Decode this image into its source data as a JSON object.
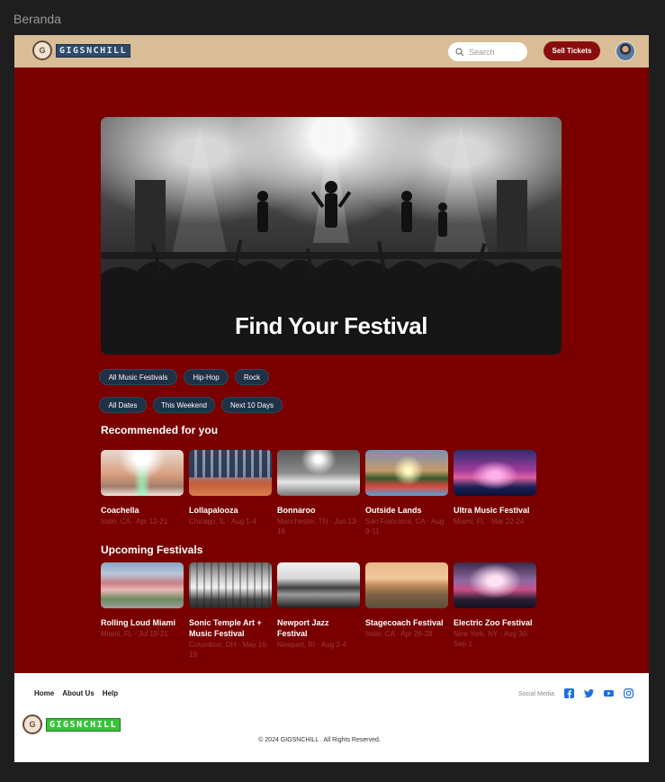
{
  "frame_title": "Beranda",
  "header": {
    "logo_mark": "G",
    "logo_text": "GIGSNCHILL",
    "search_placeholder": "Search",
    "sell_label": "Sell Tickets"
  },
  "hero": {
    "title": "Find Your Festival"
  },
  "filters": {
    "genres": [
      "All Music Festivals",
      "Hip-Hop",
      "Rock"
    ],
    "dates": [
      "All Dates",
      "This Weekend",
      "Next 10 Days"
    ]
  },
  "recommended": {
    "title": "Recommended for you",
    "items": [
      {
        "name": "Coachella",
        "date": "Indio, CA · Apr 12-21"
      },
      {
        "name": "Lollapalooza",
        "date": "Chicago, IL · Aug 1-4"
      },
      {
        "name": "Bonnaroo",
        "date": "Manchester, TN · Jun 13-16"
      },
      {
        "name": "Outside Lands",
        "date": "San Francisco, CA · Aug 9-11"
      },
      {
        "name": "Ultra Music Festival",
        "date": "Miami, FL · Mar 22-24"
      }
    ]
  },
  "upcoming": {
    "title": "Upcoming Festivals",
    "items": [
      {
        "name": "Rolling Loud Miami",
        "date": "Miami, FL · Jul 19-21"
      },
      {
        "name": "Sonic Temple Art + Music Festival",
        "date": "Columbus, OH · May 16-19"
      },
      {
        "name": "Newport Jazz Festival",
        "date": "Newport, RI · Aug 2-4"
      },
      {
        "name": "Stagecoach Festival",
        "date": "Indio, CA · Apr 26-28"
      },
      {
        "name": "Electric Zoo Festival",
        "date": "New York, NY · Aug 30-Sep 1"
      }
    ]
  },
  "footer": {
    "nav": {
      "home": "Home",
      "about": "About Us",
      "help": "Help"
    },
    "social_label": "Social Media",
    "social_icons": [
      "facebook-icon",
      "twitter-icon",
      "youtube-icon",
      "instagram-icon"
    ],
    "logo_text": "GIGSNCHILL",
    "copyright": "© 2024 GIGSNCHILL . All Rights Reserved."
  },
  "colors": {
    "page_bg": "#7a0000",
    "header_bg": "#d9bd96",
    "chip_bg": "#1f3146",
    "sell_button": "#8a0d0d",
    "footer_logo": "#38c23a",
    "social": "#1d6fe0"
  }
}
